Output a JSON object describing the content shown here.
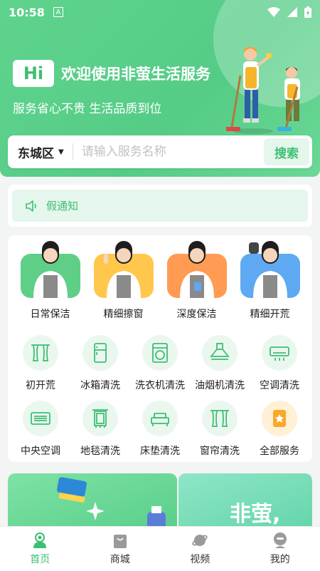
{
  "status": {
    "time": "10:58",
    "notif_icon": "A"
  },
  "hero": {
    "hi": "Hi",
    "title": "欢迎使用非萤生活服务",
    "subtitle": "服务省心不贵 生活品质到位",
    "colors": {
      "primary": "#55cc86",
      "accent": "#3dbf73"
    }
  },
  "search": {
    "city": "东城区",
    "placeholder": "请输入服务名称",
    "button": "搜索"
  },
  "notice": {
    "text": "假通知"
  },
  "services": {
    "featured": [
      {
        "label": "日常保洁",
        "bg": "#5fcf88"
      },
      {
        "label": "精细擦窗",
        "bg": "#ffc84d"
      },
      {
        "label": "深度保洁",
        "bg": "#ff9b52"
      },
      {
        "label": "精细开荒",
        "bg": "#5fa8f2"
      }
    ],
    "row1": [
      {
        "label": "初开荒",
        "icon": "curtain-icon"
      },
      {
        "label": "冰箱清洗",
        "icon": "fridge-icon"
      },
      {
        "label": "洗衣机清洗",
        "icon": "washer-icon"
      },
      {
        "label": "油烟机清洗",
        "icon": "range-hood-icon"
      },
      {
        "label": "空调清洗",
        "icon": "air-conditioner-icon"
      }
    ],
    "row2": [
      {
        "label": "中央空调",
        "icon": "central-ac-icon"
      },
      {
        "label": "地毯清洗",
        "icon": "carpet-icon"
      },
      {
        "label": "床垫清洗",
        "icon": "mattress-icon"
      },
      {
        "label": "窗帘清洗",
        "icon": "curtain-icon"
      },
      {
        "label": "全部服务",
        "icon": "star-bookmark-icon"
      }
    ]
  },
  "banners": {
    "right_text": "非萤,"
  },
  "tabbar": [
    {
      "label": "首页",
      "icon": "home-person-icon",
      "active": true
    },
    {
      "label": "商城",
      "icon": "shopping-bag-icon",
      "active": false
    },
    {
      "label": "视频",
      "icon": "planet-icon",
      "active": false
    },
    {
      "label": "我的",
      "icon": "user-icon",
      "active": false
    }
  ]
}
